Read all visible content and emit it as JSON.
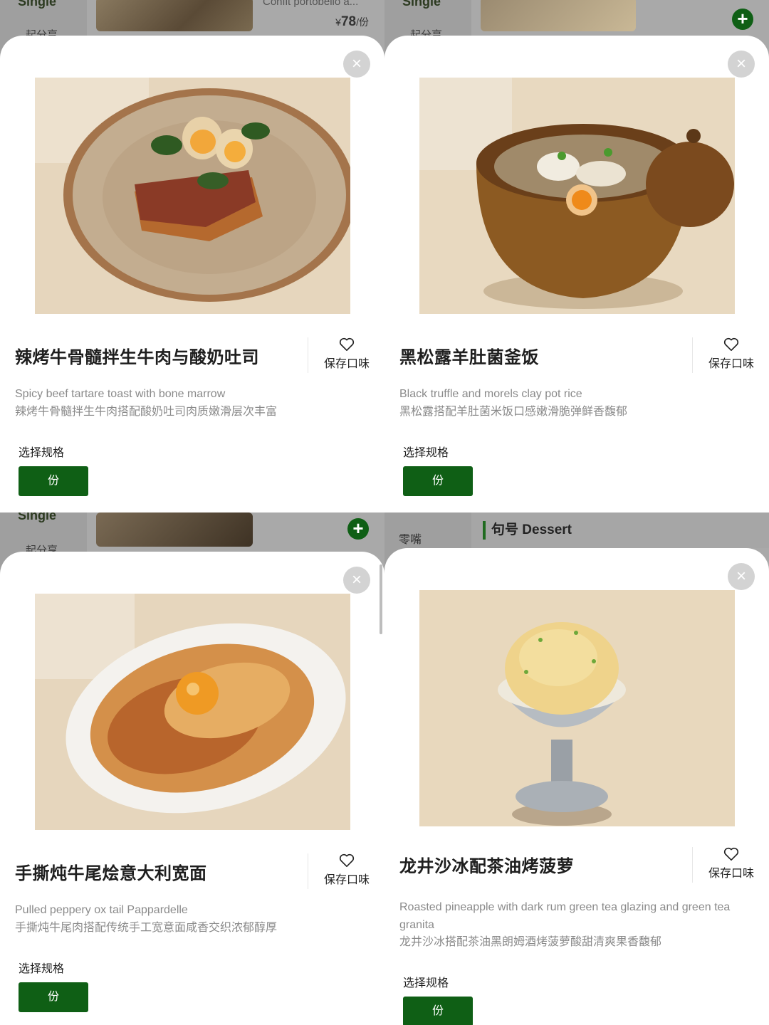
{
  "background": {
    "category_single": "Single",
    "category_sub": "起分享",
    "snack_label": "零嘴",
    "dessert_header": "句号 Dessert",
    "bg_item_name": "Confit portobello a...",
    "bg_item_price_prefix": "¥",
    "bg_item_price": "78",
    "bg_item_price_unit": "/份",
    "add_icon": "+"
  },
  "common": {
    "save_label": "保存口味",
    "spec_title": "选择规格",
    "spec_option": "份",
    "close_glyph": "×",
    "accent_color": "#0f5f15"
  },
  "cards": [
    {
      "title": "辣烤牛骨髓拌生牛肉与酸奶吐司",
      "desc_en": "Spicy beef tartare toast with bone marrow",
      "desc_cn": "辣烤牛骨髓拌生牛肉搭配酸奶吐司肉质嫩滑层次丰富"
    },
    {
      "title": "黑松露羊肚菌釜饭",
      "desc_en": "Black truffle and morels clay pot rice",
      "desc_cn": "黑松露搭配羊肚菌米饭口感嫩滑脆弹鲜香馥郁"
    },
    {
      "title": "手撕炖牛尾烩意大利宽面",
      "desc_en": "Pulled peppery ox tail Pappardelle",
      "desc_cn": "手撕炖牛尾肉搭配传统手工宽意面咸香交织浓郁醇厚"
    },
    {
      "title": "龙井沙冰配茶油烤菠萝",
      "desc_en": "Roasted pineapple with dark rum green tea glazing and green tea granita",
      "desc_cn": "龙井沙冰搭配茶油黑朗姆酒烤菠萝酸甜清爽果香馥郁"
    }
  ]
}
